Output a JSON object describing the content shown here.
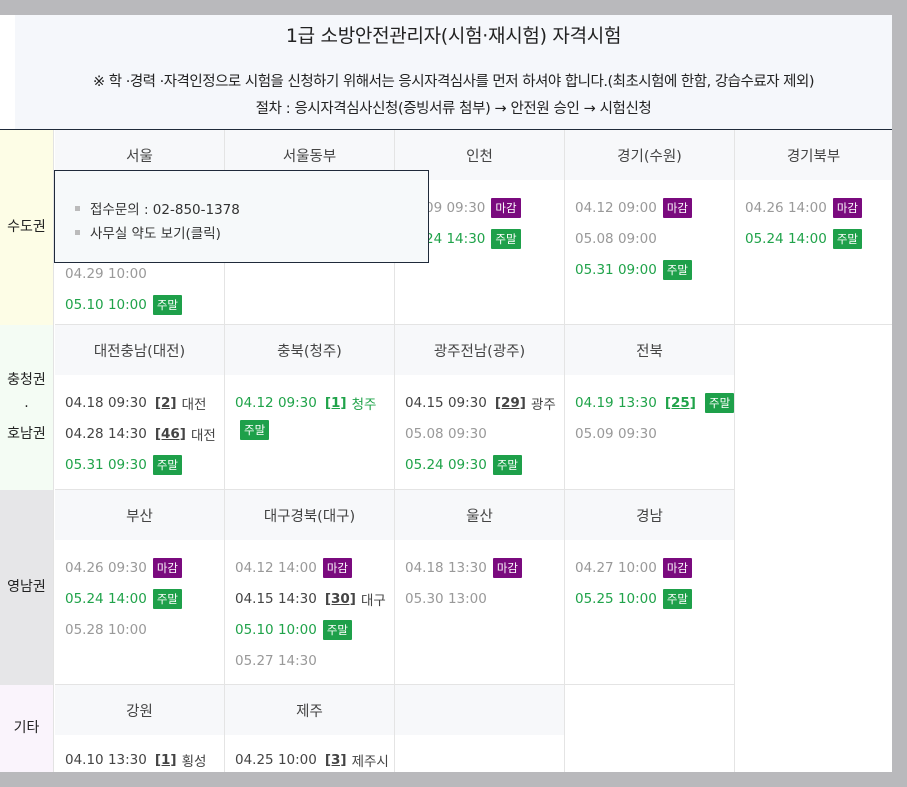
{
  "header": {
    "title": "1급 소방안전관리자(시험·재시험) 자격시험",
    "notice": "※ 학 ·경력 ·자격인정으로 시험을 신청하기 위해서는 응시자격심사를 먼저 하셔야 합니다.(최초시험에 한함, 강습수료자 제외)",
    "procedure": "절차 : 응시자격심사신청(증빙서류 첨부) → 안전원 승인 → 시험신청"
  },
  "regions": {
    "capital": "수도권",
    "chungcheong_honam_1": "충청권",
    "chungcheong_honam_2": "·",
    "chungcheong_honam_3": "호남권",
    "yeongnam": "영남권",
    "other": "기타"
  },
  "badges": {
    "closed": "마감",
    "weekend": "주말"
  },
  "colors": {
    "closed": "#7a0a7e",
    "weekend": "#1ea04a",
    "past": "#999999",
    "weekend_text": "#20a34a"
  },
  "popup": {
    "contact": "접수문의 : 02-850-1378",
    "map_link": "사무실 약도 보기(클릭)"
  },
  "cells": {
    "seoul": {
      "name": "서울",
      "rows": [
        "04.29 10:00",
        "05.10 10:00"
      ]
    },
    "seoul_east": {
      "name": "서울동부"
    },
    "incheon": {
      "name": "인천",
      "rows": [
        "09 09:30",
        "24 14:30"
      ]
    },
    "gyeonggi": {
      "name": "경기(수원)",
      "rows": [
        "04.12 09:00",
        "05.08 09:00",
        "05.31 09:00"
      ]
    },
    "gyeonggi_n": {
      "name": "경기북부",
      "rows": [
        "04.26 14:00",
        "05.24 14:00"
      ]
    },
    "daejeon": {
      "name": "대전충남(대전)",
      "rows": [
        {
          "dt": "04.18 09:30",
          "seat": "[2]",
          "place": "대전"
        },
        {
          "dt": "04.28 14:30",
          "seat": "[46]",
          "place": "대전"
        },
        {
          "dt": "05.31 09:30"
        }
      ]
    },
    "chungbuk": {
      "name": "충북(청주)",
      "rows": [
        {
          "dt": "04.12 09:30",
          "seat": "[1]",
          "place": "청주"
        }
      ]
    },
    "gwangju": {
      "name": "광주전남(광주)",
      "rows": [
        {
          "dt": "04.15 09:30",
          "seat": "[29]",
          "place": "광주"
        },
        {
          "dt": "05.08 09:30"
        },
        {
          "dt": "05.24 09:30"
        }
      ]
    },
    "jeonbuk": {
      "name": "전북",
      "rows": [
        {
          "dt": "04.19 13:30",
          "seat": "[25]"
        },
        {
          "dt": "05.09 09:30"
        }
      ]
    },
    "busan": {
      "name": "부산",
      "rows": [
        "04.26 09:30",
        "05.24 14:00",
        "05.28 10:00"
      ]
    },
    "daegu": {
      "name": "대구경북(대구)",
      "rows": [
        {
          "dt": "04.12 14:00"
        },
        {
          "dt": "04.15 14:30",
          "seat": "[30]",
          "place": "대구"
        },
        {
          "dt": "05.10 10:00"
        },
        {
          "dt": "05.27 14:30"
        }
      ]
    },
    "ulsan": {
      "name": "울산",
      "rows": [
        "04.18 13:30",
        "05.30 13:00"
      ]
    },
    "gyeongnam": {
      "name": "경남",
      "rows": [
        "04.27 10:00",
        "05.25 10:00"
      ]
    },
    "gangwon": {
      "name": "강원",
      "rows": [
        {
          "dt": "04.10 13:30",
          "seat": "[1]",
          "place": "횡성"
        }
      ]
    },
    "jeju": {
      "name": "제주",
      "rows": [
        {
          "dt": "04.25 10:00",
          "seat": "[3]",
          "place": "제주시"
        }
      ]
    }
  }
}
